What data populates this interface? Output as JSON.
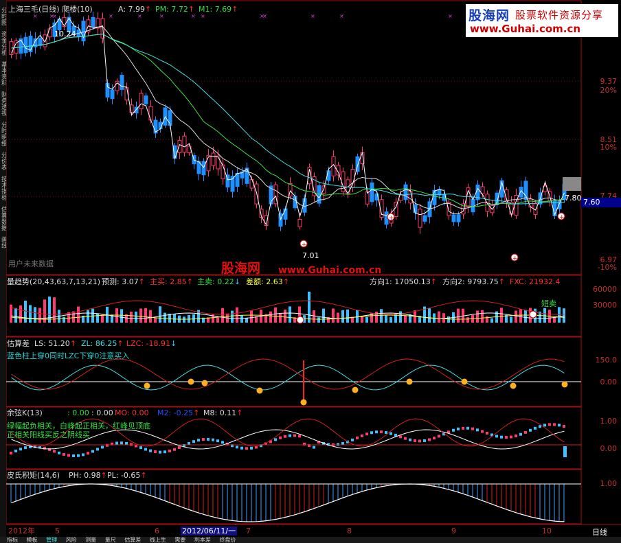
{
  "panel1": {
    "title": "上海三毛(日线) 爬楼(10)",
    "a_label": "A: 7.99",
    "pm_label": "PM: 7.72",
    "m1_label": "M1: 7.69",
    "high_marker": "10.24",
    "low_marker": "7.01",
    "last_marker": "7.80",
    "future_data": "用户未来数据",
    "scale": [
      "9.37",
      "20%",
      "8.51",
      "10%",
      "7.74",
      "6.97",
      "-10%"
    ],
    "current_price": "7.60"
  },
  "panel2": {
    "title": "量趋势(20,43,63,7,13,21)",
    "forecast": "预测: 3.07",
    "main_buy": "主买: 2.85",
    "main_sell": "主卖: 0.22",
    "diff": "差额: 2.63",
    "dir1": "方向1: 17050.13",
    "dir2": "方向2: 9793.75",
    "fxc": "FXC: 21932.4",
    "short_sell": "短卖",
    "scale": [
      "60000",
      "30000"
    ]
  },
  "panel3": {
    "title": "估算差",
    "ls": "LS: 51.20",
    "zl": "ZL: 86.25",
    "lzc": "LZC: -18.91",
    "hint": "蓝色柱上穿0同时LZC下穿0注意买入",
    "scale": [
      "150.0",
      "0.00"
    ]
  },
  "panel4": {
    "title": "余弦K(13)",
    "v1": ": 0.00",
    "v2": ": 0.00",
    "mo": "MO: 0.00",
    "m2": "M2: -0.25",
    "m8": "M8: 0.11",
    "hint1": "绿幅起负相关，白峰起正相关，红峰见顶底",
    "hint2": "正相关阳线买反之阴线买",
    "scale": [
      "1.00",
      "0.00"
    ]
  },
  "panel5": {
    "title": "皮氏积矩(14,6)",
    "ph": "PH: 0.98",
    "pl": "PL: -0.65",
    "scale": [
      "1.00"
    ]
  },
  "xaxis": {
    "labels": [
      "2012年",
      "5",
      "6",
      "7",
      "8",
      "9",
      "10"
    ],
    "current_date": "2012/06/11/一",
    "period": "日线"
  },
  "logo": {
    "brand": "股海网",
    "slogan": "股票软件资源分享",
    "url": "www.Guhai.com.cn"
  },
  "watermark": {
    "brand": "股海网",
    "url": "www.Guhai.com.cn"
  },
  "sidebar_left": [
    "分时图",
    "资金分析",
    "基本资料",
    "财务透视",
    "分时明细",
    "分价表",
    "技术指标",
    "估算数据",
    "画线"
  ],
  "bottom_tabs": [
    "指标",
    "模板",
    "管理",
    "风险",
    "测量",
    "量尺",
    "估算差",
    "线上生",
    "需要",
    "利本差",
    "终盘价"
  ],
  "colors": {
    "up": "#ff3a70",
    "down": "#1e90ff",
    "red_line": "#d02020",
    "text_red": "#ff3030",
    "text_green": "#30e040",
    "text_yellow": "#ffff40",
    "text_cyan": "#40e0e0"
  }
}
